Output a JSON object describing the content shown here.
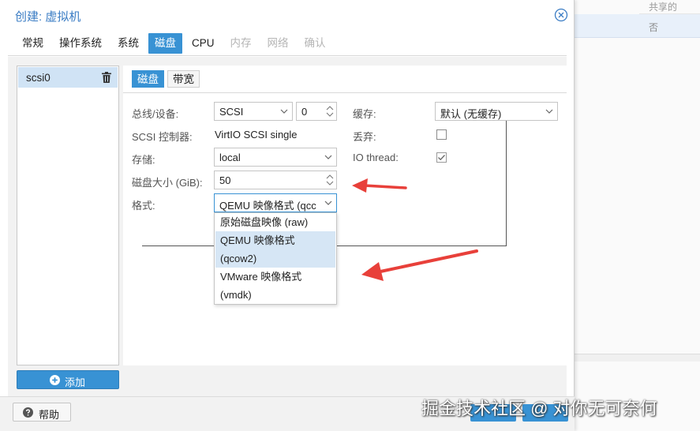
{
  "background": {
    "column_header": "共享的",
    "row_value": "否"
  },
  "dialog": {
    "title": "创建: 虚拟机",
    "tabs": [
      {
        "label": "常规",
        "state": "normal"
      },
      {
        "label": "操作系统",
        "state": "normal"
      },
      {
        "label": "系统",
        "state": "normal"
      },
      {
        "label": "磁盘",
        "state": "active"
      },
      {
        "label": "CPU",
        "state": "normal"
      },
      {
        "label": "内存",
        "state": "disabled"
      },
      {
        "label": "网络",
        "state": "disabled"
      },
      {
        "label": "确认",
        "state": "disabled"
      }
    ],
    "devices": [
      {
        "label": "scsi0"
      }
    ],
    "add_label": "添加",
    "subtabs": [
      {
        "label": "磁盘"
      },
      {
        "label": "带宽"
      }
    ],
    "form": {
      "bus_label": "总线/设备:",
      "bus_value": "SCSI",
      "device_index": "0",
      "scsi_ctrl_label": "SCSI 控制器:",
      "scsi_ctrl_value": "VirtIO SCSI single",
      "storage_label": "存储:",
      "storage_value": "local",
      "size_label": "磁盘大小 (GiB):",
      "size_value": "50",
      "format_label": "格式:",
      "format_value": "QEMU 映像格式 (qcc",
      "cache_label": "缓存:",
      "cache_value": "默认 (无缓存)",
      "discard_label": "丢弃:",
      "discard_checked": false,
      "iothread_label": "IO thread:",
      "iothread_checked": true
    },
    "format_options": [
      {
        "line1": "原始磁盘映像 (raw)",
        "line2": "",
        "selected": false
      },
      {
        "line1": "QEMU 映像格式",
        "line2": "(qcow2)",
        "selected": true
      },
      {
        "line1": "VMware 映像格式",
        "line2": "(vmdk)",
        "selected": false
      }
    ],
    "help_label": "帮助"
  },
  "watermark": "掘金技术社区 @ 对你无可奈何",
  "colors": {
    "accent": "#3892d4",
    "title": "#3a7cc4",
    "annotation_arrow": "#e8403a"
  },
  "icons": [
    "close-circle-icon",
    "trash-icon",
    "plus-circle-icon",
    "question-circle-icon",
    "chevron-down-icon",
    "spinner-icon",
    "checkbox-icon"
  ]
}
